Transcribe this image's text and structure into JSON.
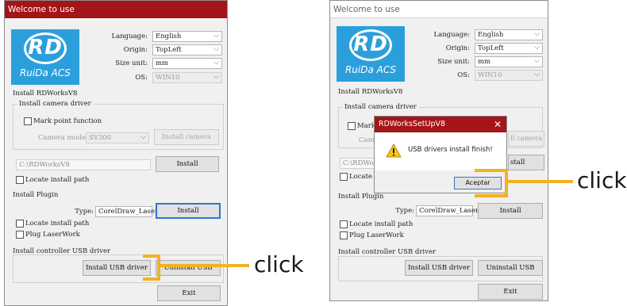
{
  "left_window": {
    "title": "Welcome to use",
    "logo": {
      "mark": "RD",
      "text": "RuiDa ACS"
    },
    "fields": [
      {
        "label": "Language:",
        "value": "English"
      },
      {
        "label": "Origin:",
        "value": "TopLeft"
      },
      {
        "label": "Size unit:",
        "value": "mm"
      },
      {
        "label": "OS:",
        "value": "WIN10"
      }
    ],
    "rdworks": {
      "section_label": "Install RDWorksV8",
      "camera_group_label": "Install camera driver",
      "mark_point_label": "Mark point function",
      "camera_model_label": "Camera model:",
      "camera_model_value": "SV300",
      "install_camera_label": "Install camera",
      "install_path": "C:\\RDWorksV8",
      "install_label": "Install",
      "locate_path_label": "Locate install path"
    },
    "plugin": {
      "section_label": "Install Plugin",
      "type_label": "Type:",
      "type_value": "CorelDraw_Laser",
      "install_label": "Install",
      "locate_path_label": "Locate install path",
      "plug_laserwork_label": "Plug LaserWork"
    },
    "usb": {
      "section_label": "Install controller USB driver",
      "install_usb_label": "Install USB driver",
      "uninstall_usb_label": "Uninstall USB"
    },
    "exit_label": "Exit"
  },
  "right_window": {
    "title": "Welcome to use",
    "logo": {
      "mark": "RD",
      "text": "RuiDa ACS"
    },
    "fields": [
      {
        "label": "Language:",
        "value": "English"
      },
      {
        "label": "Origin:",
        "value": "TopLeft"
      },
      {
        "label": "Size unit:",
        "value": "mm"
      },
      {
        "label": "OS:",
        "value": "WIN10"
      }
    ],
    "rdworks": {
      "section_label": "Install RDWorksV8",
      "camera_group_label": "Install camera driver",
      "mark_point_label_partial": "Mark p",
      "camera_model_label_partial": "Camer",
      "install_camera_label_partial": "ll camera",
      "install_path_partial": "C:\\RDWorksV",
      "install_label_partial": "stall",
      "locate_path_label_partial": "Locate in"
    },
    "plugin": {
      "section_label": "Install Plugin",
      "type_label": "Type:",
      "type_value": "CorelDraw_Laser",
      "install_label": "Install",
      "locate_path_label": "Locate install path",
      "plug_laserwork_label": "Plug LaserWork"
    },
    "usb": {
      "section_label": "Install controller USB driver",
      "install_usb_label": "Install USB driver",
      "uninstall_usb_label": "Uninstall USB"
    },
    "exit_label": "Exit",
    "dialog": {
      "title": "RDWorksSetUpV8",
      "close_glyph": "✕",
      "message": "USB drivers install finish!",
      "ok_label": "Aceptar",
      "icon": "warning-icon"
    }
  },
  "annotations": {
    "click_label": "click",
    "highlight_color": "#f2b124"
  },
  "chevron": "⌵"
}
